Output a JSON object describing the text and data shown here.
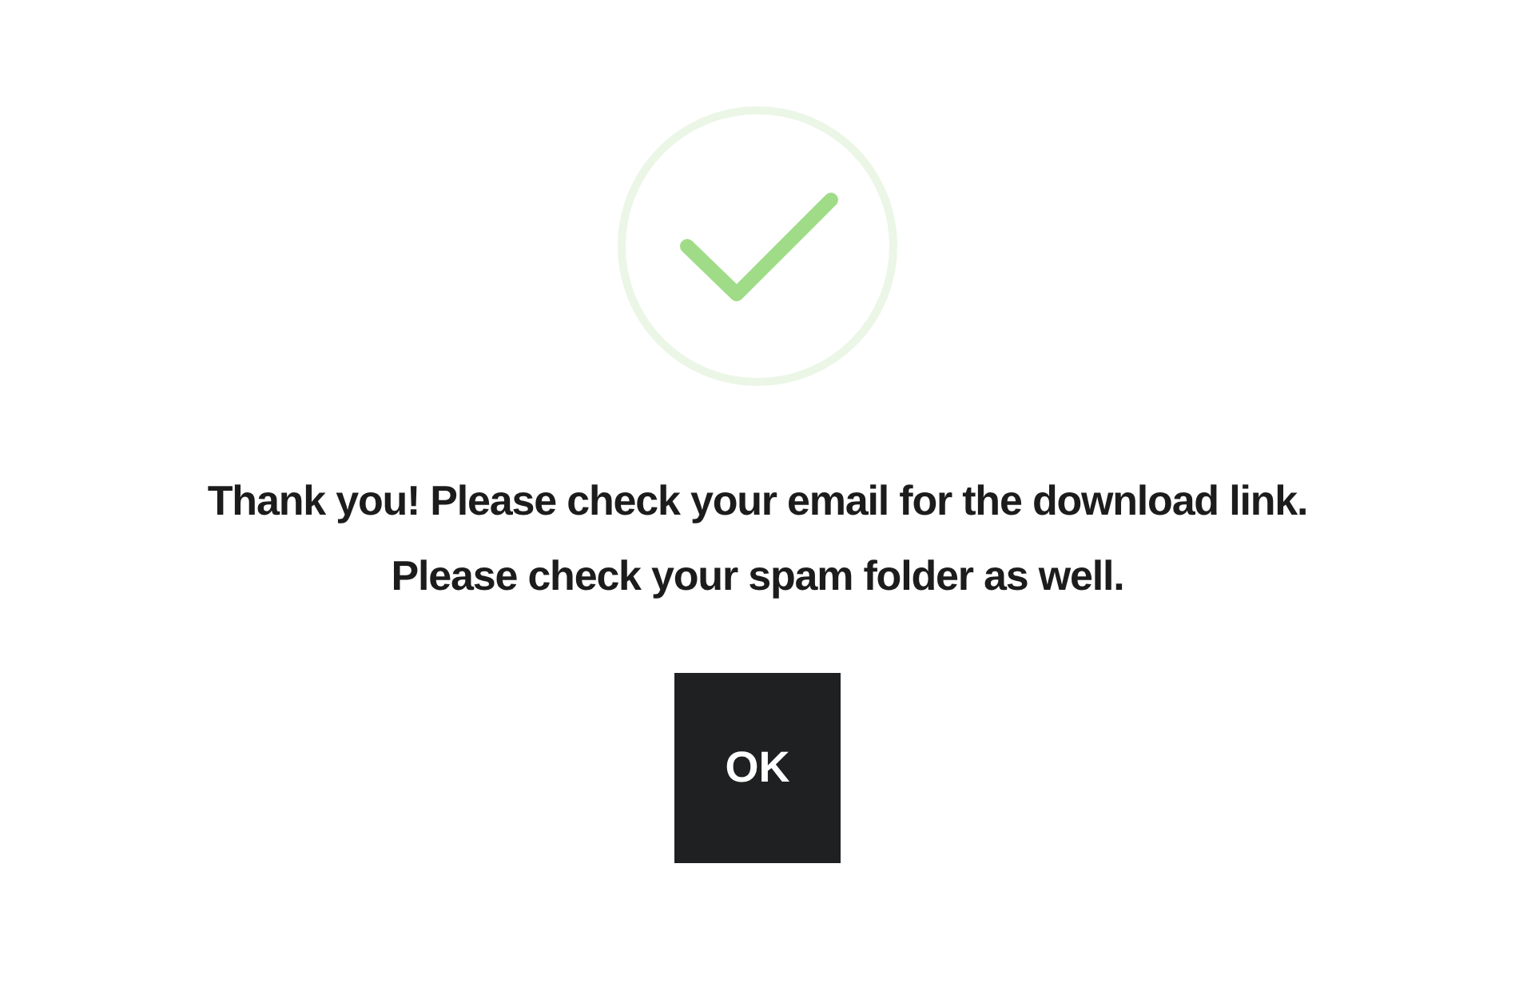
{
  "dialog": {
    "message_lines": [
      "Thank you! Please check your email for the download link.",
      "Please check your spam folder as well."
    ],
    "button": "OK"
  }
}
